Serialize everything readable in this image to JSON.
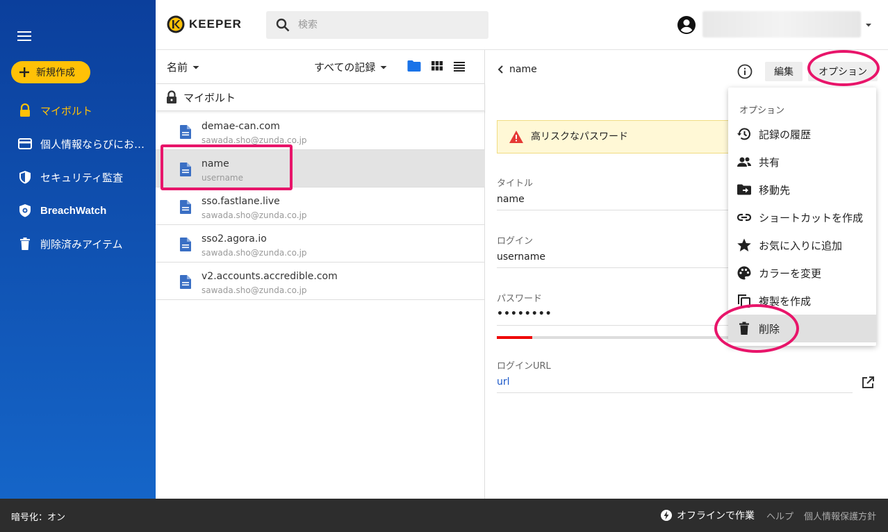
{
  "app": {
    "name": "KEEPER"
  },
  "sidebar": {
    "new_label": "新規作成",
    "items": [
      {
        "label": "マイボルト",
        "icon": "lock-icon",
        "active": true
      },
      {
        "label": "個人情報ならびにお支払い",
        "icon": "credit-card-icon",
        "active": false
      },
      {
        "label": "セキュリティ監査",
        "icon": "shield-icon",
        "active": false
      },
      {
        "label": "BreachWatch",
        "icon": "breachwatch-icon",
        "active": false
      },
      {
        "label": "削除済みアイテム",
        "icon": "trash-icon",
        "active": false
      }
    ]
  },
  "search": {
    "placeholder": "検索"
  },
  "list": {
    "sort_label": "名前",
    "filter_label": "すべての記録",
    "vault_label": "マイボルト",
    "records": [
      {
        "title": "demae-can.com",
        "sub": "sawada.sho@zunda.co.jp"
      },
      {
        "title": "name",
        "sub": "username",
        "selected": true
      },
      {
        "title": "sso.fastlane.live",
        "sub": "sawada.sho@zunda.co.jp"
      },
      {
        "title": "sso2.agora.io",
        "sub": "sawada.sho@zunda.co.jp"
      },
      {
        "title": "v2.accounts.accredible.com",
        "sub": "sawada.sho@zunda.co.jp"
      }
    ]
  },
  "detail": {
    "back_label": "name",
    "edit_label": "編集",
    "options_label": "オプション",
    "warning": "高リスクなパスワード",
    "fields": {
      "title_label": "タイトル",
      "title_value": "name",
      "login_label": "ログイン",
      "login_value": "username",
      "password_label": "パスワード",
      "password_value": "••••••••",
      "password_strength": 0.15,
      "url_label": "ログインURL",
      "url_value": "url"
    }
  },
  "options_menu": {
    "header": "オプション",
    "items": [
      {
        "label": "記録の履歴",
        "icon": "history-icon"
      },
      {
        "label": "共有",
        "icon": "share-people-icon"
      },
      {
        "label": "移動先",
        "icon": "move-folder-icon"
      },
      {
        "label": "ショートカットを作成",
        "icon": "link-icon"
      },
      {
        "label": "お気に入りに追加",
        "icon": "star-icon"
      },
      {
        "label": "カラーを変更",
        "icon": "palette-icon"
      },
      {
        "label": "複製を作成",
        "icon": "copy-icon"
      },
      {
        "label": "削除",
        "icon": "delete-icon",
        "highlighted": true
      }
    ]
  },
  "footer": {
    "encryption": "暗号化：オン",
    "offline": "オフラインで作業",
    "help": "ヘルプ",
    "privacy": "個人情報保護方針"
  },
  "colors": {
    "sidebar_top": "#0b3f9c",
    "sidebar_bottom": "#1565c8",
    "accent": "#ffc107",
    "annotation": "#e8156a",
    "link": "#1a57c8"
  }
}
